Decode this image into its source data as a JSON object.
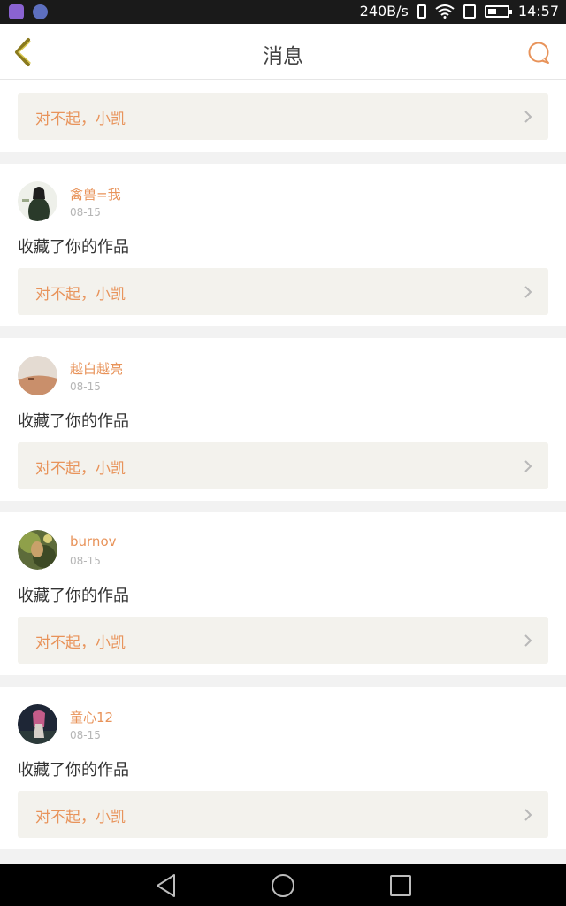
{
  "status_bar": {
    "network_speed": "240B/s",
    "time": "14:57",
    "battery_level": 0.45,
    "icons": [
      "gallery-app-icon",
      "browser-app-icon",
      "vibrate-icon",
      "wifi-icon",
      "sim-icon",
      "battery-icon"
    ]
  },
  "header": {
    "title": "消息",
    "back_icon": "chevron-left-icon",
    "chat_icon": "chat-bubble-icon"
  },
  "colors": {
    "accent": "#e8935a",
    "back_arrow": "#8a7a1e",
    "quote_bg": "#f3f2ed"
  },
  "top_card": {
    "quote": "对不起，小凯"
  },
  "messages": [
    {
      "user": "禽兽=我",
      "date": "08-15",
      "action": "收藏了你的作品",
      "quote": "对不起，小凯"
    },
    {
      "user": "越白越亮",
      "date": "08-15",
      "action": "收藏了你的作品",
      "quote": "对不起，小凯"
    },
    {
      "user": "burnov",
      "date": "08-15",
      "action": "收藏了你的作品",
      "quote": "对不起，小凯"
    },
    {
      "user": "童心12",
      "date": "08-15",
      "action": "收藏了你的作品",
      "quote": "对不起，小凯"
    }
  ],
  "nav_bar": {
    "buttons": [
      "back-triangle-icon",
      "home-circle-icon",
      "recents-square-icon"
    ]
  }
}
